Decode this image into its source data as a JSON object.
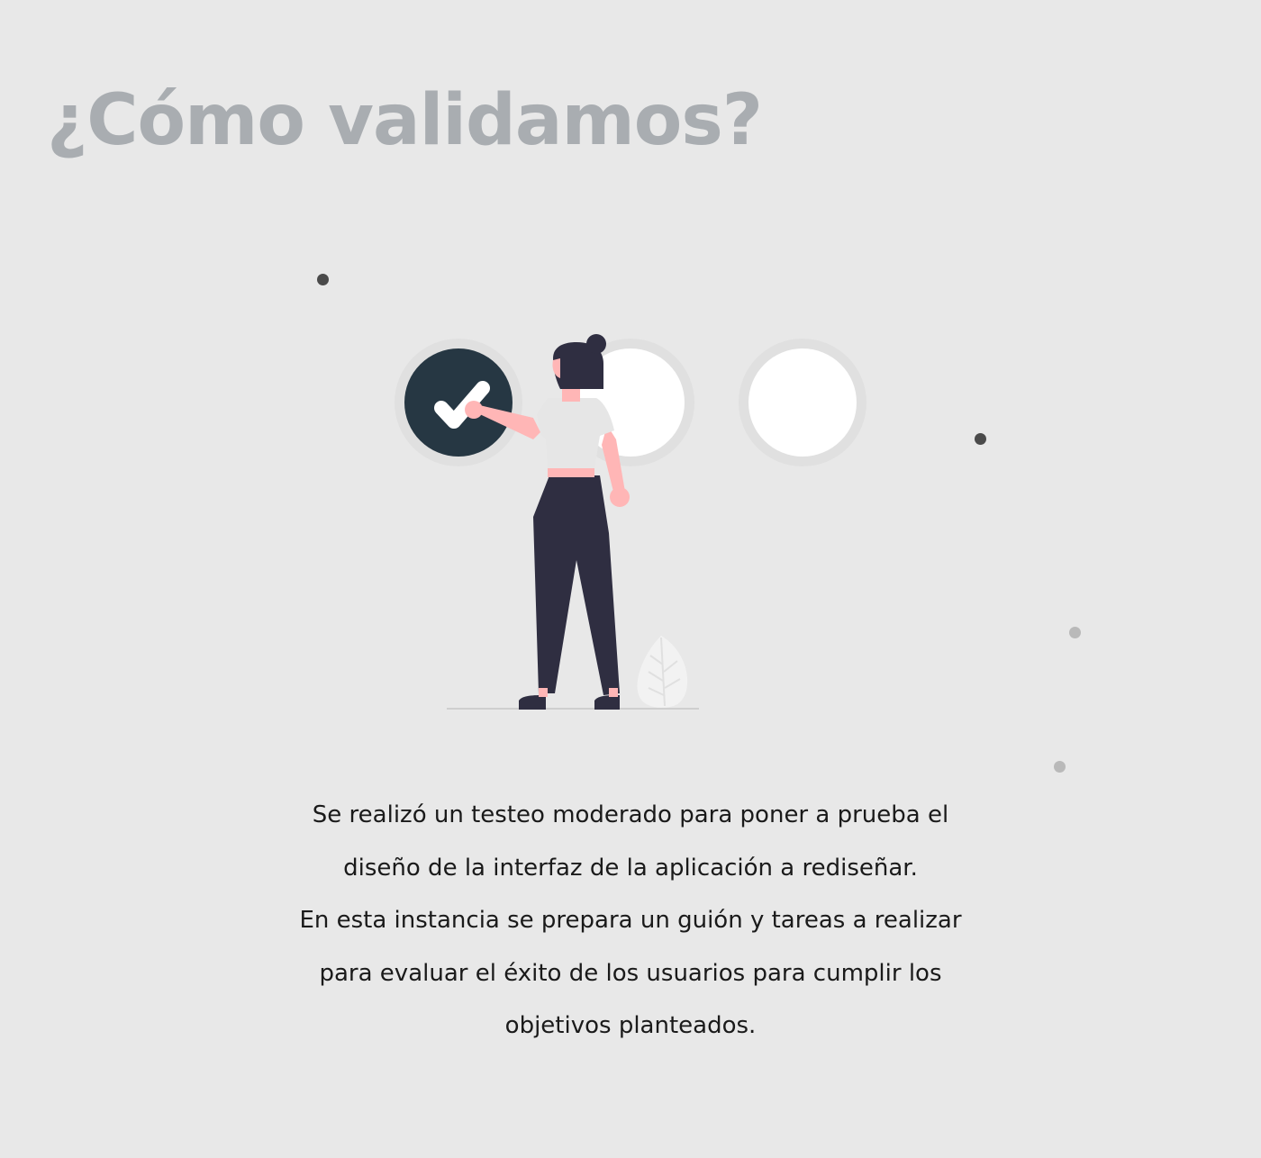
{
  "page": {
    "title": "¿Cómo validamos?",
    "description_lines": [
      "Se realizó un testeo moderado para poner a prueba el",
      "diseño de la interfaz de la aplicación a rediseñar.",
      "En esta instancia se prepara un guión y tareas a realizar",
      "para evaluar el éxito de los usuarios para cumplir los",
      "objetivos planteados."
    ]
  },
  "colors": {
    "background": "#e8e8e8",
    "title": "#a9adb1",
    "text": "#1a1a1a",
    "check_circle": "#263743",
    "pants_hair": "#2f2e41",
    "skin": "#ffb6b6",
    "shirt": "#e6e6e6",
    "circle_white": "#ffffff"
  },
  "illustration": {
    "icons": [
      "check-icon",
      "leaf-icon"
    ]
  }
}
